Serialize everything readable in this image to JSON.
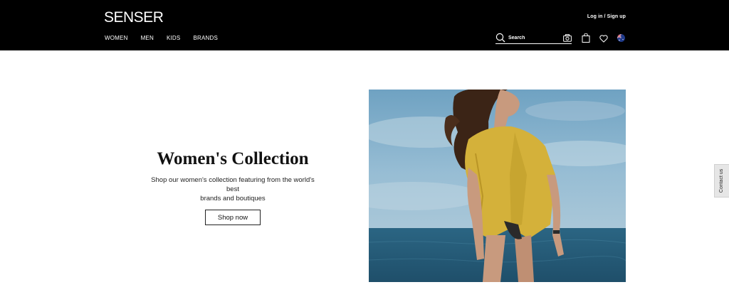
{
  "header": {
    "logo": "SENSER",
    "login": "Log in / Sign up",
    "nav": [
      "WOMEN",
      "MEN",
      "KIDS",
      "BRANDS"
    ],
    "search": {
      "placeholder": "Search"
    }
  },
  "hero": {
    "title": "Women's Collection",
    "subtitle_line1": "Shop our women's collection featuring from the world's best",
    "subtitle_line2": "brands and boutiques",
    "cta": "Shop now"
  },
  "contact_tab": {
    "label": "Contact us"
  },
  "icons": [
    "search-icon",
    "camera-icon",
    "shopping-bag-icon",
    "heart-icon",
    "flag-icon"
  ],
  "colors": {
    "header_bg": "#000000",
    "accent": "#ffffff",
    "shirt": "#d4b13a",
    "sea": "#2f6a86"
  }
}
